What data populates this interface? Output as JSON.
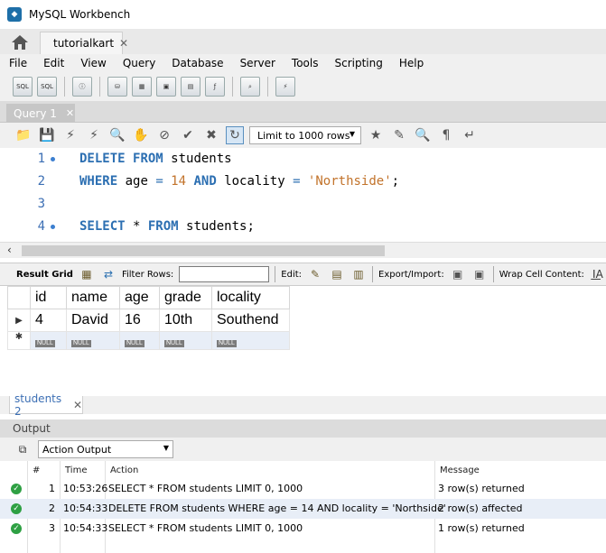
{
  "window": {
    "title": "MySQL Workbench"
  },
  "doc_tab": {
    "label": "tutorialkart",
    "close": "✕"
  },
  "menu": [
    "File",
    "Edit",
    "View",
    "Query",
    "Database",
    "Server",
    "Tools",
    "Scripting",
    "Help"
  ],
  "query_tab": {
    "label": "Query 1",
    "close": "✕"
  },
  "sql_toolbar": {
    "limit_label": "Limit to 1000 rows"
  },
  "editor": {
    "lines": [
      {
        "num": "1",
        "kw1": "DELETE",
        "kw2": "FROM",
        "rest": " students"
      },
      {
        "num": "2",
        "kw1": "WHERE",
        "t1": " age ",
        "op1": "=",
        "n1": " 14 ",
        "kw2": "AND",
        "t2": " locality ",
        "op2": "=",
        "s1": " 'Northside'",
        "end": ";"
      },
      {
        "num": "3"
      },
      {
        "num": "4",
        "kw1": "SELECT",
        "t1": " * ",
        "kw2": "FROM",
        "rest": " students;"
      }
    ]
  },
  "result_toolbar": {
    "result_grid": "Result Grid",
    "filter_rows": "Filter Rows:",
    "edit": "Edit:",
    "export_import": "Export/Import:",
    "wrap_cell": "Wrap Cell Content:"
  },
  "grid": {
    "columns": [
      "id",
      "name",
      "age",
      "grade",
      "locality"
    ],
    "rows": [
      [
        "4",
        "David",
        "16",
        "10th",
        "Southend"
      ]
    ],
    "null_label": "NULL"
  },
  "result_tab": {
    "label": "students 2",
    "close": "✕"
  },
  "output": {
    "header": "Output",
    "selector": "Action Output",
    "columns": {
      "num": "#",
      "time": "Time",
      "action": "Action",
      "message": "Message"
    },
    "rows": [
      {
        "num": "1",
        "time": "10:53:26",
        "action": "SELECT * FROM students LIMIT 0, 1000",
        "message": "3 row(s) returned"
      },
      {
        "num": "2",
        "time": "10:54:33",
        "action": "DELETE FROM students WHERE age = 14 AND locality = 'Northside'",
        "message": "2 row(s) affected"
      },
      {
        "num": "3",
        "time": "10:54:33",
        "action": "SELECT * FROM students LIMIT 0, 1000",
        "message": "1 row(s) returned"
      }
    ]
  }
}
